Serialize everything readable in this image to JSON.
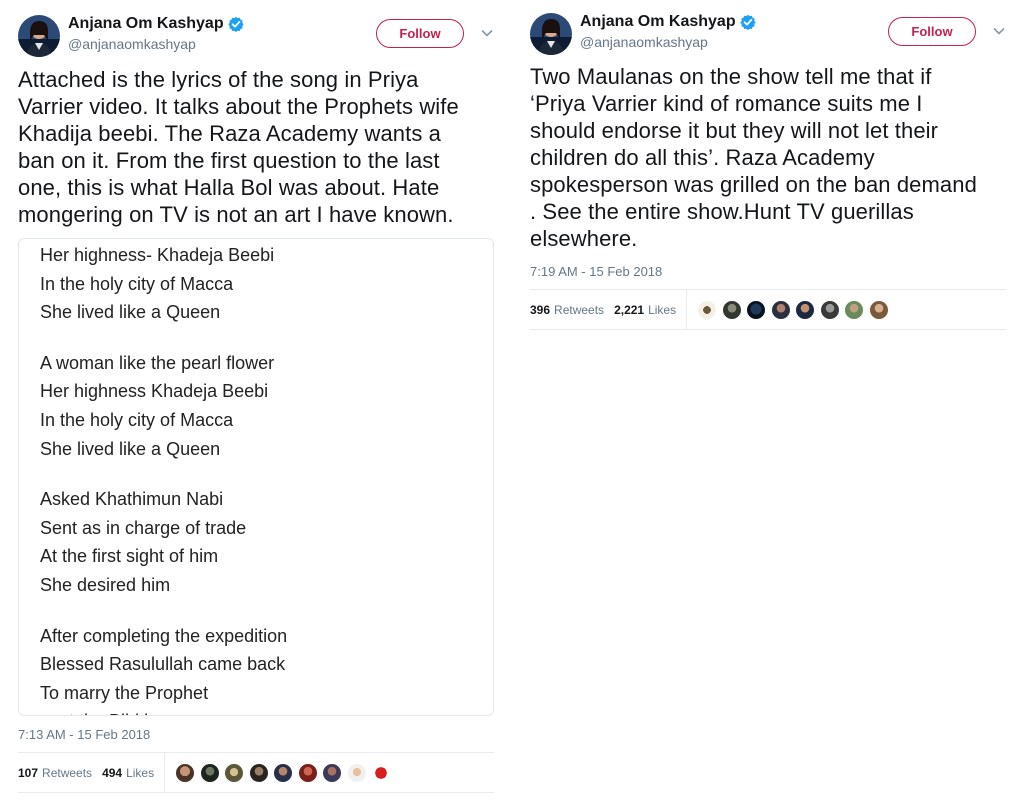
{
  "tweets": [
    {
      "author": {
        "name": "Anjana Om Kashyap",
        "handle": "@anjanaomkashyap"
      },
      "follow_label": "Follow",
      "text": "Attached is the lyrics of the song in Priya\nVarrier video. It talks about the Prophets wife\nKhadija beebi. The Raza Academy wants a\nban on it. From the first question to the last\none, this is what Halla Bol was about. Hate\nmongering on TV is not an art I have known.",
      "lyrics": [
        [
          "Her highness- Khadeja Beebi",
          "In the holy city of Macca",
          "She lived like a Queen"
        ],
        [
          "A woman like the pearl flower",
          "Her highness Khadeja Beebi",
          "In the holy city of Macca",
          "She lived like a Queen"
        ],
        [
          "Asked Khathimun Nabi",
          "Sent as in charge of trade",
          "At the first sight of him",
          "She desired him"
        ],
        [
          "After completing the expedition",
          "Blessed Rasulullah came back",
          "To marry the Prophet",
          "sent the Bibi her..."
        ]
      ],
      "timestamp": "7:13 AM - 15 Feb 2018",
      "retweets": {
        "count": "107",
        "label": "Retweets"
      },
      "likes": {
        "count": "494",
        "label": "Likes"
      }
    },
    {
      "author": {
        "name": "Anjana Om Kashyap",
        "handle": "@anjanaomkashyap"
      },
      "follow_label": "Follow",
      "text": "Two Maulanas on the show tell me that if\n‘Priya Varrier kind of romance suits me I\nshould endorse it but they will not let their\nchildren do all this’. Raza Academy\nspokesperson was grilled on the ban demand\n. See the entire show.Hunt TV guerillas\nelsewhere.",
      "timestamp": "7:19 AM - 15 Feb 2018",
      "retweets": {
        "count": "396",
        "label": "Retweets"
      },
      "likes": {
        "count": "2,221",
        "label": "Likes"
      }
    }
  ],
  "colors": {
    "follow_accent": "#c5224f",
    "verified_blue": "#1da1f2",
    "meta_gray": "#657786"
  },
  "icons": [
    "verified-badge-icon",
    "chevron-down-icon"
  ]
}
